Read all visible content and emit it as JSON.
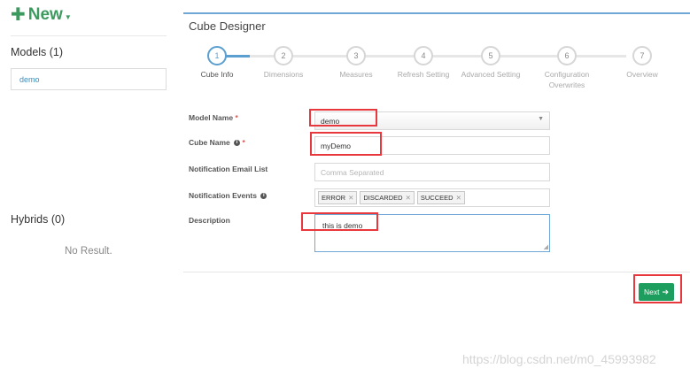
{
  "left_panel": {
    "new_label": "New",
    "models_title": "Models (1)",
    "models": [
      "demo"
    ],
    "hybrids_title": "Hybrids (0)",
    "no_result": "No Result."
  },
  "designer": {
    "title": "Cube Designer",
    "steps": [
      {
        "num": "1",
        "label": "Cube Info",
        "active": true
      },
      {
        "num": "2",
        "label": "Dimensions",
        "active": false
      },
      {
        "num": "3",
        "label": "Measures",
        "active": false
      },
      {
        "num": "4",
        "label": "Refresh Setting",
        "active": false
      },
      {
        "num": "5",
        "label": "Advanced Setting",
        "active": false
      },
      {
        "num": "6",
        "label": "Configuration Overwrites",
        "active": false
      },
      {
        "num": "7",
        "label": "Overview",
        "active": false
      }
    ],
    "form": {
      "model_name_label": "Model Name",
      "model_name_value": "demo",
      "cube_name_label": "Cube Name",
      "cube_name_value": "myDemo",
      "email_label": "Notification Email List",
      "email_placeholder": "Comma Separated",
      "events_label": "Notification Events",
      "events": [
        "ERROR",
        "DISCARDED",
        "SUCCEED"
      ],
      "description_label": "Description",
      "description_value": "this is demo",
      "required_mark": "*"
    },
    "next_label": "Next"
  },
  "watermark": "https://blog.csdn.net/m0_45993982",
  "colors": {
    "accent_green": "#1e9e5e",
    "accent_blue": "#5b9fd1",
    "highlight_red": "#e8383d"
  }
}
